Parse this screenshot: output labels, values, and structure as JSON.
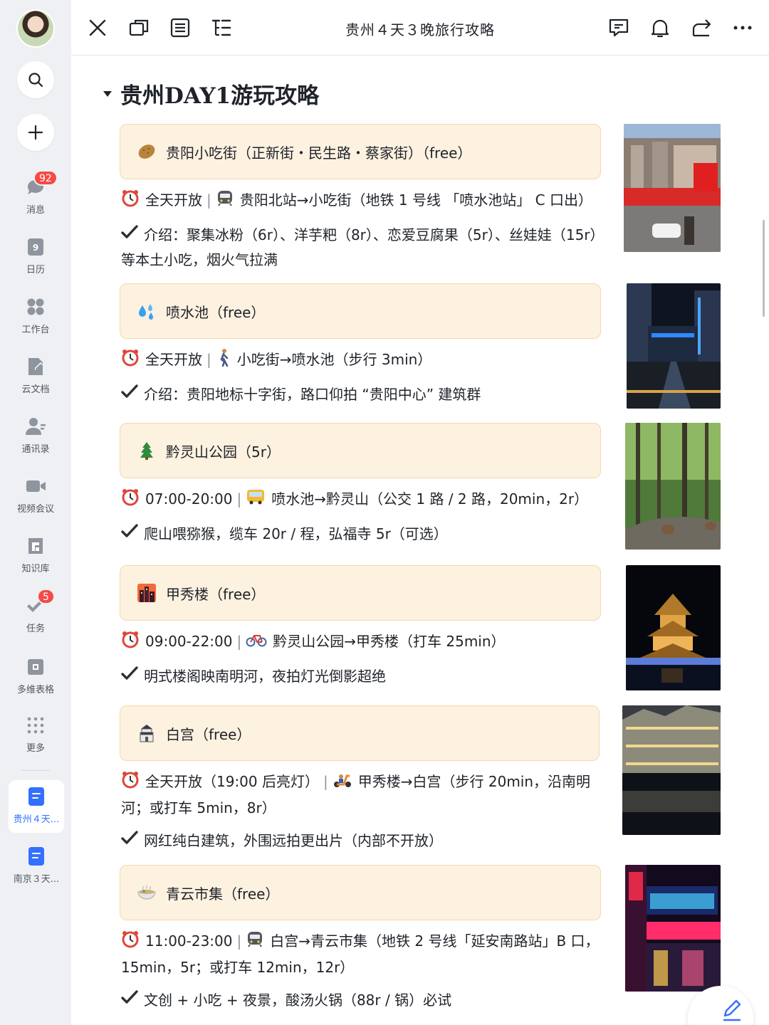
{
  "sidebar": {
    "search_icon": "search-icon",
    "add_icon": "plus-icon",
    "items": [
      {
        "label": "消息",
        "badge": "92"
      },
      {
        "label": "日历",
        "day": "9"
      },
      {
        "label": "工作台"
      },
      {
        "label": "云文档"
      },
      {
        "label": "通讯录"
      },
      {
        "label": "视频会议"
      },
      {
        "label": "知识库"
      },
      {
        "label": "任务",
        "badge": "5"
      },
      {
        "label": "多维表格"
      },
      {
        "label": "更多"
      }
    ],
    "docs": [
      {
        "label": "贵州４天...",
        "active": true
      },
      {
        "label": "南京３天...",
        "active": false
      }
    ]
  },
  "topbar": {
    "title": "贵州４天３晚旅行攻略"
  },
  "doc": {
    "heading": "贵州DAY1游玩攻略",
    "sections": [
      {
        "emoji": "potato-icon",
        "title": "贵阳小吃街（正新街・民生路・蔡家街）（free）",
        "hours": "全天开放",
        "transport_icon": "metro-icon",
        "transport": "贵阳北站→小吃街（地铁 1 号线 「喷水池站」 C 口出）",
        "intro": "介绍：聚集冰粉（6r）、洋芋粑（8r）、恋爱豆腐果（5r）、丝娃娃（15r）等本土小吃，烟火气拉满"
      },
      {
        "emoji": "droplets-icon",
        "title": "喷水池（free）",
        "hours": "全天开放",
        "transport_icon": "walking-icon",
        "transport": "小吃街→喷水池（步行 3min）",
        "intro": "介绍：贵阳地标十字街，路口仰拍 “贵阳中心” 建筑群"
      },
      {
        "emoji": "tree-icon",
        "title": "黔灵山公园（5r）",
        "hours": "07:00-20:00",
        "transport_icon": "bus-icon",
        "transport": "喷水池→黔灵山（公交 1 路 / 2 路，20min，2r）",
        "intro": "爬山喂猕猴，缆车 20r / 程，弘福寺 5r（可选）"
      },
      {
        "emoji": "cityscape-icon",
        "title": "甲秀楼（free）",
        "hours": "09:00-22:00",
        "transport_icon": "bicycle-icon",
        "transport": "黔灵山公园→甲秀楼（打车 25min）",
        "intro": "明式楼阁映南明河，夜拍灯光倒影超绝"
      },
      {
        "emoji": "castle-icon",
        "title": "白宫（free）",
        "hours": "全天开放（19:00 后亮灯）",
        "transport_icon": "scooter-icon",
        "transport": "甲秀楼→白宫（步行 20min，沿南明河；或打车 5min，8r）",
        "intro": "网红纯白建筑，外围远拍更出片（内部不开放）"
      },
      {
        "emoji": "bowl-icon",
        "title": "青云市集（free）",
        "hours": "11:00-23:00",
        "transport_icon": "metro-icon",
        "transport": "白宫→青云市集（地铁 2 号线「延安南路站」B 口，15min，5r；或打车 12min，12r）",
        "intro": "文创 + 小吃 + 夜景，酸汤火锅（88r / 锅）必试"
      }
    ]
  },
  "colors": {
    "accent": "#3370ff",
    "badge": "#f54a45",
    "callout_bg": "#fdf1e0",
    "callout_border": "#f4d9ad"
  }
}
